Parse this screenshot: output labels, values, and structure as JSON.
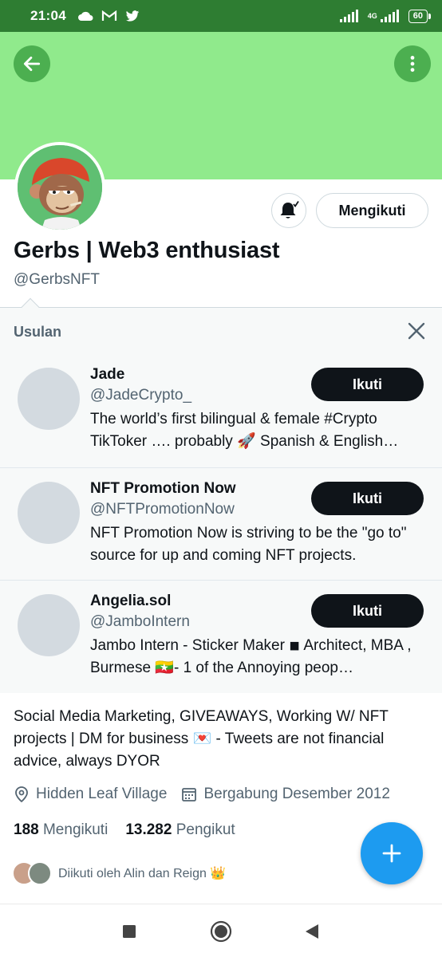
{
  "status_bar": {
    "time": "21:04",
    "network": "4G",
    "battery": "60"
  },
  "header": {
    "back_icon": "arrow-left-icon",
    "more_icon": "more-vertical-icon",
    "banner_color": "#90ea8c"
  },
  "profile": {
    "display_name": "Gerbs | Web3 enthusiast",
    "handle": "@GerbsNFT",
    "following_button": "Mengikuti",
    "bio": "Social Media Marketing, GIVEAWAYS, Working W/ NFT projects | DM for business 💌 - Tweets are not financial advice, always DYOR",
    "location": "Hidden Leaf Village",
    "joined": "Bergabung Desember 2012",
    "following_count": "188",
    "following_label": "Mengikuti",
    "followers_count": "13.282",
    "followers_label": "Pengikut",
    "followed_by": "Diikuti oleh Alin dan Reign 👑"
  },
  "suggestions": {
    "title": "Usulan",
    "items": [
      {
        "name": "Jade",
        "handle": "@JadeCrypto_",
        "bio": "The world’s first bilingual & female #Crypto TikToker …. probably 🚀 Spanish & English…",
        "button": "Ikuti"
      },
      {
        "name": "NFT Promotion Now",
        "handle": "@NFTPromotionNow",
        "bio": "NFT Promotion Now is striving to be the \"go to\" source for up and coming NFT projects.",
        "button": "Ikuti"
      },
      {
        "name": "Angelia.sol",
        "handle": "@JamboIntern",
        "bio": "Jambo Intern - Sticker Maker ◾ Architect, MBA , Burmese 🇲🇲- 1 of the Annoying peop…",
        "button": "Ikuti"
      }
    ]
  },
  "colors": {
    "accent": "#1d9bf0",
    "status_bar": "#2e7d32",
    "header_button": "#4caf50"
  }
}
